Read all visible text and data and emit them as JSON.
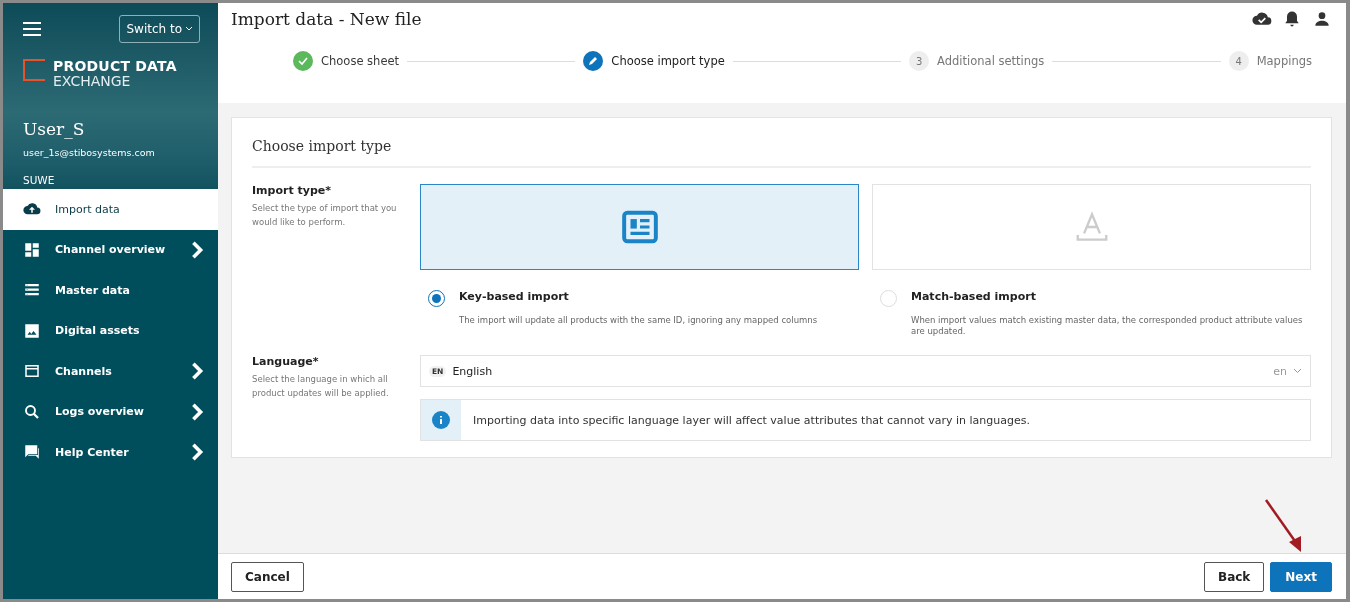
{
  "sidebar": {
    "switch_button": "Switch to",
    "logo": {
      "line1": "PRODUCT DATA",
      "line2": "EXCHANGE"
    },
    "user": {
      "name": "User_S",
      "email": "user_1s@stibosystems.com",
      "org": "SUWE"
    },
    "items": [
      {
        "label": "Import data",
        "selected": true,
        "has_submenu": false
      },
      {
        "label": "Channel overview",
        "selected": false,
        "has_submenu": true
      },
      {
        "label": "Master data",
        "selected": false,
        "has_submenu": false
      },
      {
        "label": "Digital assets",
        "selected": false,
        "has_submenu": false
      },
      {
        "label": "Channels",
        "selected": false,
        "has_submenu": true
      },
      {
        "label": "Logs overview",
        "selected": false,
        "has_submenu": true
      },
      {
        "label": "Help Center",
        "selected": false,
        "has_submenu": true
      }
    ]
  },
  "header": {
    "title": "Import data - New file"
  },
  "steps": [
    {
      "label": "Choose sheet",
      "completed": true,
      "current": false
    },
    {
      "label": "Choose import type",
      "completed": false,
      "current": true
    },
    {
      "number": "3",
      "label": "Additional settings",
      "completed": false,
      "current": false
    },
    {
      "number": "4",
      "label": "Mappings",
      "completed": false,
      "current": false
    }
  ],
  "card": {
    "title": "Choose import type",
    "import_type": {
      "label": "Import type*",
      "help": "Select the type of import that you would like to perform.",
      "options": [
        {
          "kind": "key",
          "title": "Key-based import",
          "description": "The import will update all products with the same ID, ignoring any mapped columns",
          "selected": true
        },
        {
          "kind": "match",
          "title": "Match-based import",
          "description": "When import values match existing master data, the corresponded product attribute values are updated.",
          "selected": false
        }
      ]
    },
    "language": {
      "label": "Language*",
      "help": "Select the language in which all product updates will be applied.",
      "badge": "EN",
      "value": "English",
      "code": "en"
    },
    "info": "Importing data into specific language layer will affect value attributes that cannot vary in languages."
  },
  "footer": {
    "cancel": "Cancel",
    "back": "Back",
    "next": "Next"
  }
}
